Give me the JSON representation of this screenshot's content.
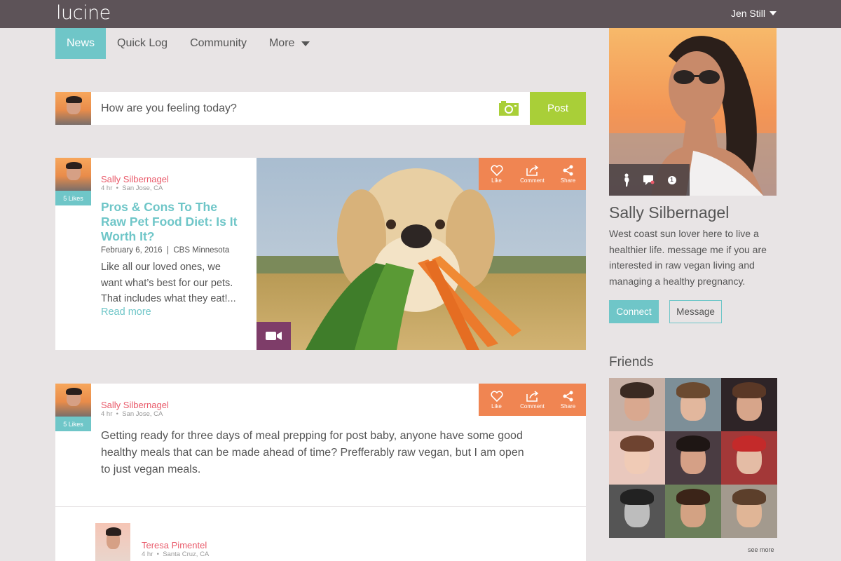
{
  "app": {
    "logo": "lucine"
  },
  "header": {
    "user_name": "Jen Still"
  },
  "nav": {
    "items": [
      {
        "label": "News",
        "active": true
      },
      {
        "label": "Quick Log",
        "active": false
      },
      {
        "label": "Community",
        "active": false
      },
      {
        "label": "More",
        "active": false
      }
    ]
  },
  "composer": {
    "placeholder": "How are you feeling today?",
    "post_label": "Post"
  },
  "actions": {
    "like": "Like",
    "comment": "Comment",
    "share": "Share"
  },
  "posts": [
    {
      "author": "Sally Silbernagel",
      "time": "4 hr",
      "location": "San Jose, CA",
      "likes": "5 Likes",
      "title": "Pros & Cons To The Raw Pet Food Diet: Is It Worth It?",
      "date": "February 6, 2016",
      "source": "CBS Minnesota",
      "excerpt": "Like all our loved ones, we want what’s best for our pets. That includes what they eat!...",
      "read_more": "Read more"
    },
    {
      "author": "Sally Silbernagel",
      "time": "4 hr",
      "location": "San Jose, CA",
      "likes": "5 Likes",
      "body": "Getting ready for three days of meal prepping for post baby, anyone have some good healthy meals that can be made ahead of time? Prefferably raw vegan, but I am open to just vegan meals."
    }
  ],
  "comment": {
    "author": "Teresa Pimentel",
    "time": "4 hr",
    "location": "Santa Cruz, CA"
  },
  "profile": {
    "name": "Sally Silbernagel",
    "bio": "West coast sun lover here to live a healthier life. message me if you are interested in raw vegan living and managing a healthy pregnancy.",
    "connect_label": "Connect",
    "message_label": "Message",
    "notification_count": "1"
  },
  "friends": {
    "title": "Friends",
    "see_more": "see more"
  },
  "colors": {
    "teal": "#6fc6c8",
    "green": "#a9cf38",
    "orange": "#f08552",
    "pink": "#e95a6a",
    "purple": "#7e3d69",
    "topbar": "#5d5358"
  }
}
